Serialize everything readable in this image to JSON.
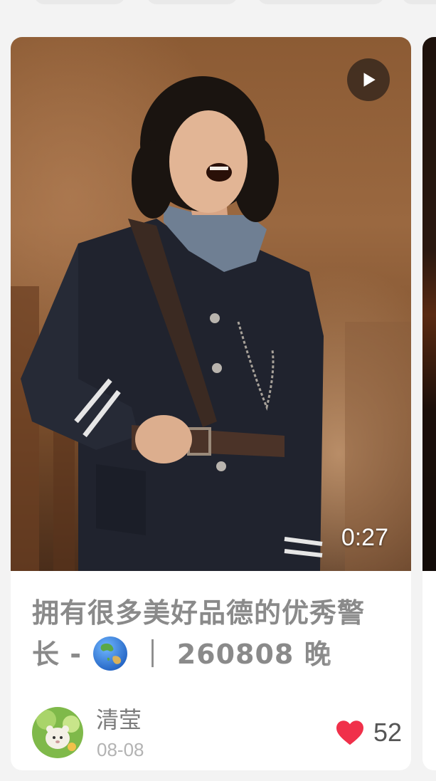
{
  "feed": {
    "card": {
      "duration": "0:27",
      "title_before_icon": "拥有很多美好品德的优秀警长 - ",
      "title_icon": "globe-asia-australia-icon",
      "title_after_icon": " ｜ 260808 晚",
      "author": {
        "name": "清莹",
        "date": "08-08"
      },
      "likes": {
        "count": "52",
        "icon": "heart-icon"
      }
    }
  },
  "colors": {
    "background": "#f3f3f3",
    "card": "#ffffff",
    "title_text": "#8a8a8a",
    "like_heart": "#f0304a"
  }
}
